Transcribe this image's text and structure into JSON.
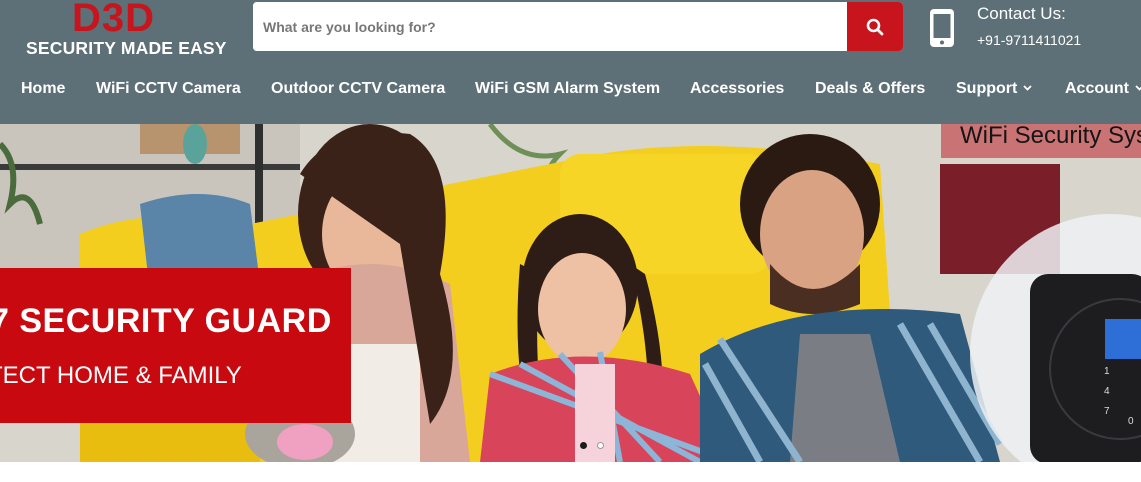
{
  "brand": {
    "logo_text": "D3D",
    "tagline": "SECURITY MADE EASY",
    "brand_color": "#c8141c",
    "header_color": "#5d6f77"
  },
  "search": {
    "placeholder": "What are you looking for?",
    "button_icon": "search-icon"
  },
  "contact": {
    "icon": "mobile-phone-icon",
    "title": "Contact Us:",
    "phone": "+91-9711411021"
  },
  "nav": {
    "items": [
      {
        "label": "Home"
      },
      {
        "label": "WiFi CCTV Camera"
      },
      {
        "label": "Outdoor CCTV Camera"
      },
      {
        "label": "WiFi GSM Alarm System"
      },
      {
        "label": "Accessories"
      },
      {
        "label": "Deals & Offers"
      },
      {
        "label": "Support",
        "dropdown": true
      },
      {
        "label": "Account",
        "dropdown": true
      }
    ]
  },
  "hero": {
    "headline": "7 SECURITY GUARD",
    "subline": "TECT HOME & FAMILY",
    "corner_tag": "WiFi Security Sys",
    "slides": 2,
    "active_slide": 1
  }
}
